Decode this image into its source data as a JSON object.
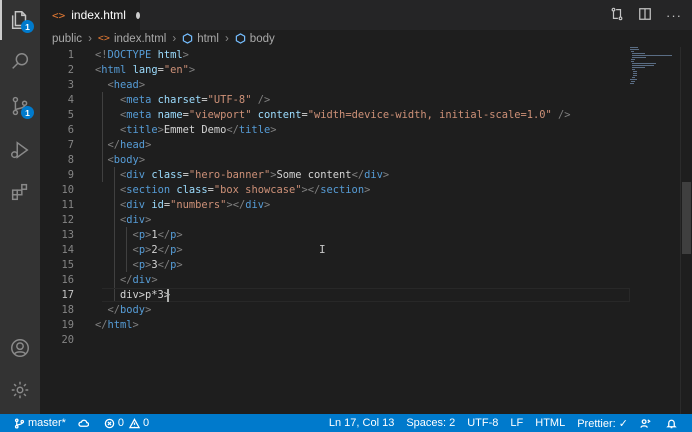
{
  "activity_bar": {
    "explorer_badge": "1",
    "source_control_badge": "1"
  },
  "tab": {
    "label": "index.html",
    "icon": "html-file-icon"
  },
  "breadcrumb": {
    "folder": "public",
    "file": "index.html",
    "element1": "html",
    "element2": "body"
  },
  "code_lines": [
    {
      "n": "1",
      "tokens": [
        [
          "t-punct",
          "<!"
        ],
        [
          "t-tag",
          "DOCTYPE"
        ],
        [
          "t-text",
          " "
        ],
        [
          "t-attr",
          "html"
        ],
        [
          "t-punct",
          ">"
        ]
      ]
    },
    {
      "n": "2",
      "tokens": [
        [
          "t-punct",
          "<"
        ],
        [
          "t-tag",
          "html"
        ],
        [
          "t-text",
          " "
        ],
        [
          "t-attr",
          "lang"
        ],
        [
          "t-text",
          "="
        ],
        [
          "t-str",
          "\"en\""
        ],
        [
          "t-punct",
          ">"
        ]
      ]
    },
    {
      "n": "3",
      "tokens": [
        [
          "t-text",
          "  "
        ],
        [
          "t-punct",
          "<"
        ],
        [
          "t-tag",
          "head"
        ],
        [
          "t-punct",
          ">"
        ]
      ]
    },
    {
      "n": "4",
      "tokens": [
        [
          "t-text",
          "    "
        ],
        [
          "t-punct",
          "<"
        ],
        [
          "t-tag",
          "meta"
        ],
        [
          "t-text",
          " "
        ],
        [
          "t-attr",
          "charset"
        ],
        [
          "t-text",
          "="
        ],
        [
          "t-str",
          "\"UTF-8\""
        ],
        [
          "t-text",
          " "
        ],
        [
          "t-punct",
          "/>"
        ]
      ]
    },
    {
      "n": "5",
      "tokens": [
        [
          "t-text",
          "    "
        ],
        [
          "t-punct",
          "<"
        ],
        [
          "t-tag",
          "meta"
        ],
        [
          "t-text",
          " "
        ],
        [
          "t-attr",
          "name"
        ],
        [
          "t-text",
          "="
        ],
        [
          "t-str",
          "\"viewport\""
        ],
        [
          "t-text",
          " "
        ],
        [
          "t-attr",
          "content"
        ],
        [
          "t-text",
          "="
        ],
        [
          "t-str",
          "\"width=device-width, initial-scale=1.0\""
        ],
        [
          "t-text",
          " "
        ],
        [
          "t-punct",
          "/>"
        ]
      ]
    },
    {
      "n": "6",
      "tokens": [
        [
          "t-text",
          "    "
        ],
        [
          "t-punct",
          "<"
        ],
        [
          "t-tag",
          "title"
        ],
        [
          "t-punct",
          ">"
        ],
        [
          "t-text",
          "Emmet Demo"
        ],
        [
          "t-punct",
          "</"
        ],
        [
          "t-tag",
          "title"
        ],
        [
          "t-punct",
          ">"
        ]
      ]
    },
    {
      "n": "7",
      "tokens": [
        [
          "t-text",
          "  "
        ],
        [
          "t-punct",
          "</"
        ],
        [
          "t-tag",
          "head"
        ],
        [
          "t-punct",
          ">"
        ]
      ]
    },
    {
      "n": "8",
      "tokens": [
        [
          "t-text",
          "  "
        ],
        [
          "t-punct",
          "<"
        ],
        [
          "t-tag",
          "body"
        ],
        [
          "t-punct",
          ">"
        ]
      ]
    },
    {
      "n": "9",
      "tokens": [
        [
          "t-text",
          "    "
        ],
        [
          "t-punct",
          "<"
        ],
        [
          "t-tag",
          "div"
        ],
        [
          "t-text",
          " "
        ],
        [
          "t-attr",
          "class"
        ],
        [
          "t-text",
          "="
        ],
        [
          "t-str",
          "\"hero-banner\""
        ],
        [
          "t-punct",
          ">"
        ],
        [
          "t-text",
          "Some content"
        ],
        [
          "t-punct",
          "</"
        ],
        [
          "t-tag",
          "div"
        ],
        [
          "t-punct",
          ">"
        ]
      ]
    },
    {
      "n": "10",
      "tokens": [
        [
          "t-text",
          "    "
        ],
        [
          "t-punct",
          "<"
        ],
        [
          "t-tag",
          "section"
        ],
        [
          "t-text",
          " "
        ],
        [
          "t-attr",
          "class"
        ],
        [
          "t-text",
          "="
        ],
        [
          "t-str",
          "\"box showcase\""
        ],
        [
          "t-punct",
          "></"
        ],
        [
          "t-tag",
          "section"
        ],
        [
          "t-punct",
          ">"
        ]
      ]
    },
    {
      "n": "11",
      "tokens": [
        [
          "t-text",
          "    "
        ],
        [
          "t-punct",
          "<"
        ],
        [
          "t-tag",
          "div"
        ],
        [
          "t-text",
          " "
        ],
        [
          "t-attr",
          "id"
        ],
        [
          "t-text",
          "="
        ],
        [
          "t-str",
          "\"numbers\""
        ],
        [
          "t-punct",
          "></"
        ],
        [
          "t-tag",
          "div"
        ],
        [
          "t-punct",
          ">"
        ]
      ]
    },
    {
      "n": "12",
      "tokens": [
        [
          "t-text",
          "    "
        ],
        [
          "t-punct",
          "<"
        ],
        [
          "t-tag",
          "div"
        ],
        [
          "t-punct",
          ">"
        ]
      ]
    },
    {
      "n": "13",
      "tokens": [
        [
          "t-text",
          "      "
        ],
        [
          "t-punct",
          "<"
        ],
        [
          "t-tag",
          "p"
        ],
        [
          "t-punct",
          ">"
        ],
        [
          "t-text",
          "1"
        ],
        [
          "t-punct",
          "</"
        ],
        [
          "t-tag",
          "p"
        ],
        [
          "t-punct",
          ">"
        ]
      ]
    },
    {
      "n": "14",
      "tokens": [
        [
          "t-text",
          "      "
        ],
        [
          "t-punct",
          "<"
        ],
        [
          "t-tag",
          "p"
        ],
        [
          "t-punct",
          ">"
        ],
        [
          "t-text",
          "2"
        ],
        [
          "t-punct",
          "</"
        ],
        [
          "t-tag",
          "p"
        ],
        [
          "t-punct",
          ">"
        ]
      ]
    },
    {
      "n": "15",
      "tokens": [
        [
          "t-text",
          "      "
        ],
        [
          "t-punct",
          "<"
        ],
        [
          "t-tag",
          "p"
        ],
        [
          "t-punct",
          ">"
        ],
        [
          "t-text",
          "3"
        ],
        [
          "t-punct",
          "</"
        ],
        [
          "t-tag",
          "p"
        ],
        [
          "t-punct",
          ">"
        ]
      ]
    },
    {
      "n": "16",
      "tokens": [
        [
          "t-text",
          "    "
        ],
        [
          "t-punct",
          "</"
        ],
        [
          "t-tag",
          "div"
        ],
        [
          "t-punct",
          ">"
        ]
      ]
    },
    {
      "n": "17",
      "tokens": [
        [
          "t-text",
          "    div>p*3>"
        ]
      ]
    },
    {
      "n": "18",
      "tokens": [
        [
          "t-text",
          "  "
        ],
        [
          "t-punct",
          "</"
        ],
        [
          "t-tag",
          "body"
        ],
        [
          "t-punct",
          ">"
        ]
      ]
    },
    {
      "n": "19",
      "tokens": [
        [
          "t-punct",
          "</"
        ],
        [
          "t-tag",
          "html"
        ],
        [
          "t-punct",
          ">"
        ]
      ]
    },
    {
      "n": "20",
      "tokens": []
    }
  ],
  "current_line": "17",
  "status": {
    "branch": "master*",
    "errors": "0",
    "warnings": "0",
    "position": "Ln 17, Col 13",
    "spaces": "Spaces: 2",
    "encoding": "UTF-8",
    "eol": "LF",
    "language": "HTML",
    "prettier": "Prettier: ✓"
  }
}
